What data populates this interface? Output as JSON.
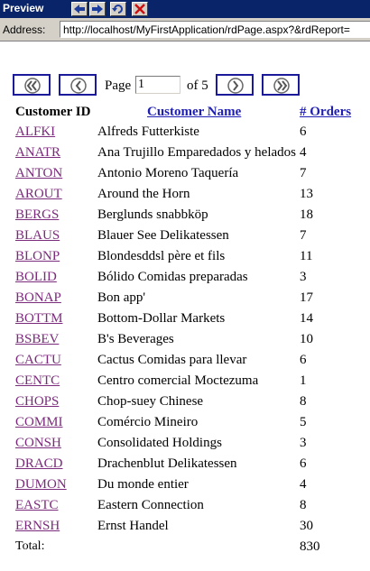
{
  "window": {
    "title": "Preview",
    "address_label": "Address:",
    "url": "http://localhost/MyFirstApplication/rdPage.aspx?&rdReport="
  },
  "toolbar": {
    "back_icon": "back-arrow-icon",
    "forward_icon": "forward-arrow-icon",
    "refresh_icon": "refresh-icon",
    "stop_icon": "close-icon"
  },
  "pager": {
    "page_label": "Page",
    "page_value": "1",
    "of_label": "of 5",
    "first_icon": "first-page-icon",
    "prev_icon": "previous-page-icon",
    "next_icon": "next-page-icon",
    "last_icon": "last-page-icon"
  },
  "table": {
    "headers": {
      "customer_id": "Customer ID",
      "customer_name": "Customer Name",
      "orders": "# Orders"
    },
    "rows": [
      {
        "id": "ALFKI",
        "name": "Alfreds Futterkiste",
        "orders": "6"
      },
      {
        "id": "ANATR",
        "name": "Ana Trujillo Emparedados y helados",
        "orders": "4"
      },
      {
        "id": "ANTON",
        "name": "Antonio Moreno Taquería",
        "orders": "7"
      },
      {
        "id": "AROUT",
        "name": "Around the Horn",
        "orders": "13"
      },
      {
        "id": "BERGS",
        "name": "Berglunds snabbköp",
        "orders": "18"
      },
      {
        "id": "BLAUS",
        "name": "Blauer See Delikatessen",
        "orders": "7"
      },
      {
        "id": "BLONP",
        "name": "Blondesddsl père et fils",
        "orders": "11"
      },
      {
        "id": "BOLID",
        "name": "Bólido Comidas preparadas",
        "orders": "3"
      },
      {
        "id": "BONAP",
        "name": "Bon app'",
        "orders": "17"
      },
      {
        "id": "BOTTM",
        "name": "Bottom-Dollar Markets",
        "orders": "14"
      },
      {
        "id": "BSBEV",
        "name": "B's Beverages",
        "orders": "10"
      },
      {
        "id": "CACTU",
        "name": "Cactus Comidas para llevar",
        "orders": "6"
      },
      {
        "id": "CENTC",
        "name": "Centro comercial Moctezuma",
        "orders": "1"
      },
      {
        "id": "CHOPS",
        "name": "Chop-suey Chinese",
        "orders": "8"
      },
      {
        "id": "COMMI",
        "name": "Comércio Mineiro",
        "orders": "5"
      },
      {
        "id": "CONSH",
        "name": "Consolidated Holdings",
        "orders": "3"
      },
      {
        "id": "DRACD",
        "name": "Drachenblut Delikatessen",
        "orders": "6"
      },
      {
        "id": "DUMON",
        "name": "Du monde entier",
        "orders": "4"
      },
      {
        "id": "EASTC",
        "name": "Eastern Connection",
        "orders": "8"
      },
      {
        "id": "ERNSH",
        "name": "Ernst Handel",
        "orders": "30"
      }
    ],
    "total_label": "Total:",
    "total_value": "830"
  }
}
